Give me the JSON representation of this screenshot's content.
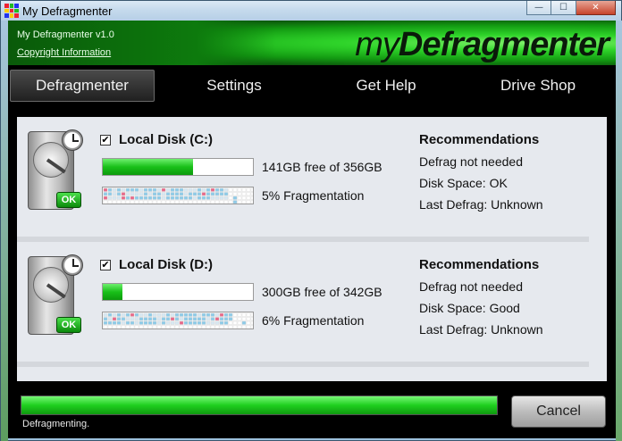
{
  "window": {
    "title": "My Defragmenter",
    "controls": {
      "minimize": "—",
      "maximize": "☐",
      "close": "✕"
    }
  },
  "header": {
    "version": "My Defragmenter v1.0",
    "copyright_link": "Copyright Information",
    "brand_light": "my",
    "brand_bold": "Defragmenter",
    "accent": "#2fd42a"
  },
  "nav": {
    "tabs": [
      {
        "label": "Defragmenter",
        "active": true
      },
      {
        "label": "Settings",
        "active": false
      },
      {
        "label": "Get Help",
        "active": false
      },
      {
        "label": "Drive Shop",
        "active": false
      }
    ]
  },
  "disks": [
    {
      "checkbox": "✔",
      "label": "Local Disk (C:)",
      "space_text": "141GB free of 356GB",
      "space_used_fraction": 0.6,
      "frag_text": "5% Fragmentation",
      "status_badge": "OK",
      "recommendations": {
        "title": "Recommendations",
        "lines": [
          "Defrag not needed",
          "Disk Space: OK",
          "Last Defrag: Unknown"
        ]
      },
      "icons": {
        "drive": "hard-drive-icon",
        "clock": "clock-icon"
      }
    },
    {
      "checkbox": "✔",
      "label": "Local Disk (D:)",
      "space_text": "300GB free of 342GB",
      "space_used_fraction": 0.13,
      "frag_text": "6% Fragmentation",
      "status_badge": "OK",
      "recommendations": {
        "title": "Recommendations",
        "lines": [
          "Defrag not needed",
          "Disk Space: Good",
          "Last Defrag: Unknown"
        ]
      },
      "icons": {
        "drive": "hard-drive-icon",
        "clock": "clock-icon"
      }
    }
  ],
  "footer": {
    "progress_fraction": 1.0,
    "status": "Defragmenting.",
    "cancel_label": "Cancel"
  }
}
